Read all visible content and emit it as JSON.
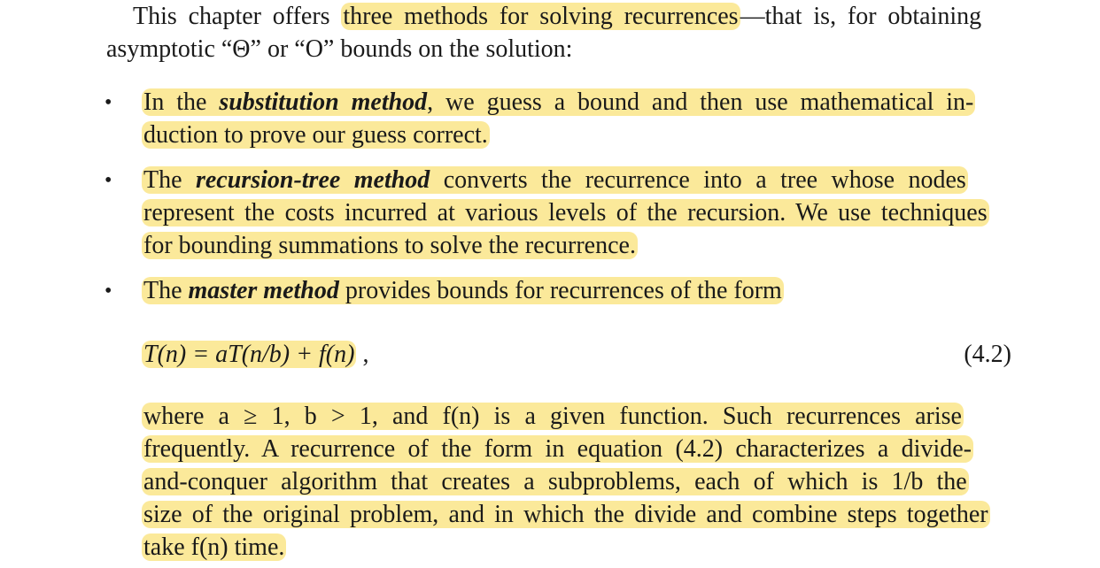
{
  "intro": {
    "line1_a": "This chapter offers ",
    "line1_hl": "three methods for solving recurrences",
    "line1_b": "—that is, for obtaining",
    "line2": "asymptotic “Θ” or “O” bounds on the solution:"
  },
  "bullet_glyph": "•",
  "substitution": {
    "l1_a": "In the ",
    "term": "substitution method",
    "l1_b": ", we guess a bound and then use mathematical in-",
    "l2": "duction to prove our guess correct."
  },
  "recursion_tree": {
    "l1_a": "The ",
    "term": "recursion-tree method",
    "l1_b": " converts the recurrence into a tree whose nodes",
    "l2": "represent the costs incurred at various levels of the recursion. We use techniques",
    "l3": "for bounding summations to solve the recurrence."
  },
  "master": {
    "l1_a": "The ",
    "term": "master method",
    "l1_b": " provides bounds for recurrences of the form",
    "equation": "T(n) = aT(n/b) + f(n)",
    "equation_tail": " ,",
    "equation_number": "(4.2)",
    "l2": "where a ≥ 1, b > 1, and f(n) is a given function. Such recurrences arise",
    "l3": "frequently. A recurrence of the form in equation (4.2) characterizes a divide-",
    "l4": "and-conquer algorithm that creates a subproblems, each of which is 1/b the",
    "l5": "size of the original problem, and in which the divide and combine steps together",
    "l6": "take f(n) time."
  }
}
